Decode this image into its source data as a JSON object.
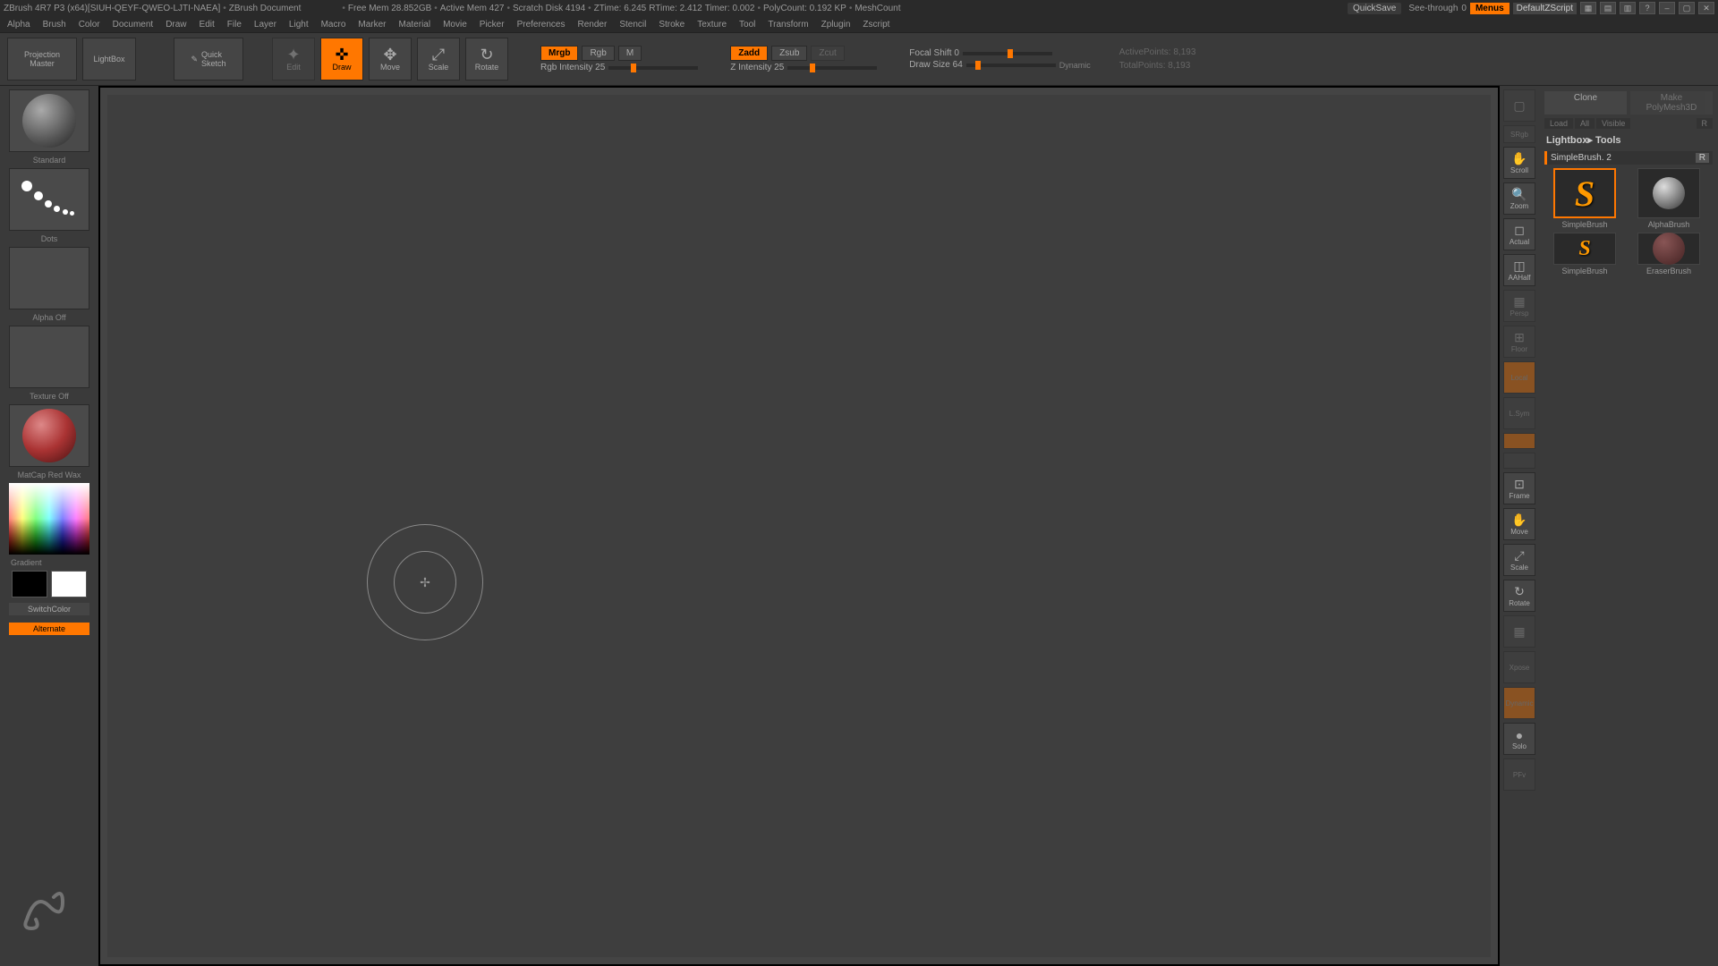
{
  "titlebar": {
    "app": "ZBrush 4R7 P3 (x64)[SIUH-QEYF-QWEO-LJTI-NAEA]",
    "doc": "ZBrush Document",
    "freemem": "Free Mem 28.852GB",
    "activemem": "Active Mem 427",
    "scratch": "Scratch Disk 4194",
    "ztime": "ZTime: 6.245",
    "rtime": "RTime: 2.412",
    "timer": "Timer: 0.002",
    "polycount": "PolyCount: 0.192 KP",
    "meshcount": "MeshCount",
    "quicksave": "QuickSave",
    "seethrough": "See-through",
    "seethrough_val": "0",
    "menus": "Menus",
    "script": "DefaultZScript"
  },
  "menubar": [
    "Alpha",
    "Brush",
    "Color",
    "Document",
    "Draw",
    "Edit",
    "File",
    "Layer",
    "Light",
    "Macro",
    "Marker",
    "Material",
    "Movie",
    "Picker",
    "Preferences",
    "Render",
    "Stencil",
    "Stroke",
    "Texture",
    "Tool",
    "Transform",
    "Zplugin",
    "Zscript"
  ],
  "toolbar": {
    "projection": "Projection\nMaster",
    "lightbox": "LightBox",
    "quicksketch": "Quick\nSketch",
    "edit": "Edit",
    "draw": "Draw",
    "move": "Move",
    "scale": "Scale",
    "rotate": "Rotate",
    "mrgb": "Mrgb",
    "rgb": "Rgb",
    "m": "M",
    "rgb_intensity": "Rgb Intensity 25",
    "zadd": "Zadd",
    "zsub": "Zsub",
    "zcut": "Zcut",
    "z_intensity": "Z Intensity 25",
    "focal_shift": "Focal Shift 0",
    "draw_size": "Draw Size 64",
    "dynamic": "Dynamic",
    "activepoints": "ActivePoints: 8,193",
    "totalpoints": "TotalPoints: 8,193"
  },
  "left": {
    "brush_label": "Standard",
    "stroke_label": "Dots",
    "alpha_label": "Alpha Off",
    "texture_label": "Texture Off",
    "material_label": "MatCap Red Wax",
    "gradient": "Gradient",
    "switchcolor": "SwitchColor",
    "alternate": "Alternate"
  },
  "right_toolbar": {
    "srgb": "SRgb",
    "scroll": "Scroll",
    "zoom": "Zoom",
    "actual": "Actual",
    "aahalf": "AAHalf",
    "persp": "Persp",
    "floor": "Floor",
    "local": "Local",
    "lsym": "L.Sym",
    "frame": "Frame",
    "move": "Move",
    "scale": "Scale",
    "rotate": "Rotate",
    "xpose": "Xpose",
    "dynamic": "Dynamic",
    "solo": "Solo",
    "pfv": "PFv"
  },
  "right_panel": {
    "clone": "Clone",
    "make": "Make PolyMesh3D",
    "load": "Load",
    "all": "All",
    "visible": "Visible",
    "r": "R",
    "title": "Lightbox▸ Tools",
    "subtitle": "SimpleBrush. 2",
    "tools": [
      {
        "name": "SimpleBrush"
      },
      {
        "name": "AlphaBrush"
      },
      {
        "name": "SimpleBrush"
      },
      {
        "name": "EraserBrush"
      }
    ]
  }
}
